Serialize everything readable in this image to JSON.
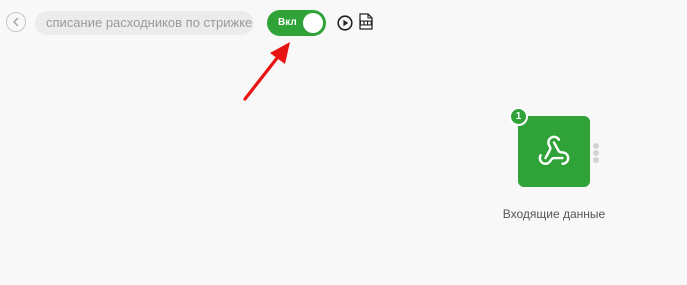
{
  "header": {
    "process_title": "списание расходников по стрижке",
    "toggle": {
      "label": "Вкл",
      "state": "on",
      "color": "#2fa338"
    },
    "icons": {
      "back": "chevron-left-icon",
      "run": "play-icon",
      "log": "log-file-icon"
    }
  },
  "annotation": {
    "color": "#e81414"
  },
  "canvas": {
    "nodes": [
      {
        "badge": "1",
        "icon": "webhook-icon",
        "label": "Входящие данные",
        "color": "#2fa338"
      }
    ]
  }
}
